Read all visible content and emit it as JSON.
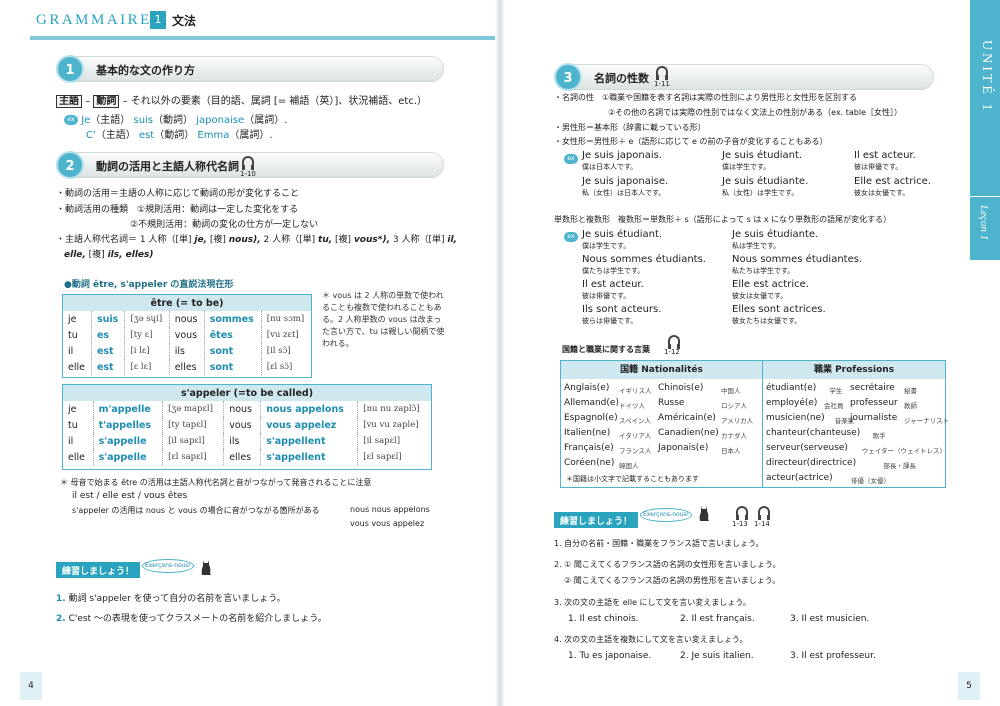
{
  "header": {
    "gram": "GRAMMAIRE",
    "num": "1",
    "jp": "文法"
  },
  "sec1": {
    "num": "1",
    "title": "基本的な文の作り方",
    "rule_subj": "主語",
    "rule_dash1": "–",
    "rule_verb": "動詞",
    "rule_rest": "– それ以外の要素（目的語、属詞 [= 補語（英）]、状況補語、etc.）",
    "ex_badge": "ex",
    "ex1_a": "Je",
    "ex1_b": "（主語）",
    "ex1_c": "suis",
    "ex1_d": "（動詞）",
    "ex1_e": "japonaise",
    "ex1_f": "（属詞）.",
    "ex2_a": "C'",
    "ex2_b": "（主語）",
    "ex2_c": "est",
    "ex2_d": "（動詞）",
    "ex2_e": "Emma",
    "ex2_f": "（属詞）."
  },
  "sec2": {
    "num": "2",
    "title": "動詞の活用と主語人称代名詞",
    "track": "1-10",
    "l1": "・動詞の活用＝主語の人称に応じて動詞の形が変化すること",
    "l2": "・動詞活用の種類　①規則活用：動詞は一定した変化をする",
    "l3": "②不規則活用：動詞の変化の仕方が一定しない",
    "l4a": "・主語人称代名詞＝ 1 人称（[単]",
    "l4b": "je,",
    "l4c": "[複]",
    "l4d": "nous),",
    "l4e": "2 人称（[単]",
    "l4f": "tu,",
    "l4g": "[複]",
    "l4h": "vous*),",
    "l4i": "3 人称（[単]",
    "l4j": "il,",
    "l5a": "elle,",
    "l5b": "[複]",
    "l5c": "ils, elles)",
    "table_caption": "●動詞 être, s'appeler の直説法現在形",
    "etre_header": "être (= to be)",
    "etre_rows": [
      [
        "je",
        "suis",
        "[ʒə sɥi]",
        "nous",
        "sommes",
        "[nu sɔm]"
      ],
      [
        "tu",
        "es",
        "[ty ɛ]",
        "vous",
        "êtes",
        "[vu zɛt]"
      ],
      [
        "il",
        "est",
        "[i lɛ]",
        "ils",
        "sont",
        "[il sɔ̃]"
      ],
      [
        "elle",
        "est",
        "[ɛ lɛ]",
        "elles",
        "sont",
        "[ɛl sɔ̃]"
      ]
    ],
    "app_header": "s'appeler (=to be called)",
    "app_rows": [
      [
        "je",
        "m'appelle",
        "[ʒə mapɛl]",
        "nous",
        "nous appelons",
        "[nu nu zaplɔ̃]"
      ],
      [
        "tu",
        "t'appelles",
        "[ty tapɛl]",
        "vous",
        "vous appelez",
        "[vu vu zaple]"
      ],
      [
        "il",
        "s'appelle",
        "[il sapɛl]",
        "ils",
        "s'appellent",
        "[il sapɛl]"
      ],
      [
        "elle",
        "s'appelle",
        "[ɛl sapɛl]",
        "elles",
        "s'appellent",
        "[ɛl sapɛl]"
      ]
    ],
    "note": "＊ vous は 2 人称の単数で使われることも複数で使われることもある。2 人称単数の vous は改まった言い方で、tu は親しい間柄で使われる。",
    "liaison1": "＊ 母音で始まる être の活用は主語人称代名詞と音がつながって発音されることに注意",
    "liaison2": "il est / elle est / vous êtes",
    "liaison3": "s'appeler の活用は nous と vous の場合に音がつながる箇所がある",
    "liaison4": "nous nous appelons",
    "liaison5": "vous vous appelez"
  },
  "practice_left": {
    "tag": "練習しましょう！",
    "oval": "Exerçons-nous!",
    "q1_num": "1.",
    "q1": "動詞 s'appeler を使って自分の名前を言いましょう。",
    "q2_num": "2.",
    "q2": "C'est 〜の表現を使ってクラスメートの名前を紹介しましょう。"
  },
  "page_left": "4",
  "page_right": "5",
  "side": {
    "unite": "UNITÉ 1",
    "lecon": "Leçon 1"
  },
  "sec3": {
    "num": "3",
    "title": "名詞の性数",
    "track": "1-11",
    "g1": "・名詞の性　①職業や国籍を表す名詞は実際の性別により男性形と女性形を区別する",
    "g2": "②その他の名詞では実際の性別ではなく文法上の性別がある（ex. table［女性］）",
    "g3": "・男性形＝基本形（辞書に載っている形）",
    "g4": "・女性形＝男性形＋ e（語形に応じて e の前の子音が変化することもある）",
    "ex_badge": "ex",
    "gen_examples": [
      {
        "fr": "Je suis japonais.",
        "jp": "僕は日本人です。"
      },
      {
        "fr": "Je suis étudiant.",
        "jp": "僕は学生です。"
      },
      {
        "fr": "Il est acteur.",
        "jp": "彼は俳優です。"
      },
      {
        "fr": "Je suis japonaise.",
        "jp": "私（女性）は日本人です。"
      },
      {
        "fr": "Je suis étudiante.",
        "jp": "私（女性）は学生です。"
      },
      {
        "fr": "Elle est actrice.",
        "jp": "彼女は女優です。"
      }
    ],
    "num_rule": "単数形と複数形　複数形＝単数形＋ s（語形によって s は x になり単数形の語尾が変化する）",
    "num_examples": [
      {
        "fr": "Je suis étudiant.",
        "jp": "僕は学生です。"
      },
      {
        "fr": "Je suis étudiante.",
        "jp": "私は学生です。"
      },
      {
        "fr": "Nous sommes étudiants.",
        "jp": "僕たちは学生です。"
      },
      {
        "fr": "Nous sommes étudiantes.",
        "jp": "私たちは学生です。"
      },
      {
        "fr": "Il est acteur.",
        "jp": "彼は俳優です。"
      },
      {
        "fr": "Elle est actrice.",
        "jp": "彼女は女優です。"
      },
      {
        "fr": "Ils sont acteurs.",
        "jp": "彼らは俳優です。"
      },
      {
        "fr": "Elles sont actrices.",
        "jp": "彼女たちは女優です。"
      }
    ],
    "vocab_title": "国籍と職業に関する言葉",
    "vocab_track": "1-12",
    "nat_header": "国籍 Nationalités",
    "prof_header": "職業 Professions",
    "nat_rows": [
      [
        "Anglais(e)",
        "イギリス人",
        "Chinois(e)",
        "中国人"
      ],
      [
        "Allemand(e)",
        "ドイツ人",
        "Russe",
        "ロシア人"
      ],
      [
        "Espagnol(e)",
        "スペイン人",
        "Américain(e)",
        "アメリカ人"
      ],
      [
        "Italien(ne)",
        "イタリア人",
        "Canadien(ne)",
        "カナダ人"
      ],
      [
        "Français(e)",
        "フランス人",
        "Japonais(e)",
        "日本人"
      ],
      [
        "Coréen(ne)",
        "韓国人",
        "",
        ""
      ]
    ],
    "nat_note": "＊国籍は小文字で記載することもあります",
    "prof_rows": [
      [
        "étudiant(e)",
        "学生",
        "secrétaire",
        "秘書"
      ],
      [
        "employé(e)",
        "会社員",
        "professeur",
        "教師"
      ],
      [
        "musicien(ne)",
        "音楽家",
        "journaliste",
        "ジャーナリスト"
      ],
      [
        "chanteur(chanteuse)",
        "歌手",
        "",
        ""
      ],
      [
        "serveur(serveuse)",
        "ウェイター（ウェイトレス）",
        "",
        ""
      ],
      [
        "directeur(directrice)",
        "部長・課長",
        "",
        ""
      ],
      [
        "acteur(actrice)",
        "俳優（女優）",
        "",
        ""
      ]
    ]
  },
  "practice_right": {
    "tag": "練習しましょう！",
    "oval": "Exerçons-nous!",
    "track1": "1-13",
    "track2": "1-14",
    "q1": "1.  自分の名前・国籍・職業をフランス語で言いましょう。",
    "q2a": "2. ① 聞こえてくるフランス語の名詞の女性形を言いましょう。",
    "q2b": "② 聞こえてくるフランス語の名詞の男性形を言いましょう。",
    "q3": "3.  次の文の主語を elle にして文を言い変えましょう。",
    "q3_items": [
      "1. Il est chinois.",
      "2. Il est français.",
      "3. Il est musicien."
    ],
    "q4": "4.  次の文の主語を複数にして文を言い変えましょう。",
    "q4_items": [
      "1. Tu es japonaise.",
      "2. Je suis italien.",
      "3. Il est professeur."
    ]
  }
}
